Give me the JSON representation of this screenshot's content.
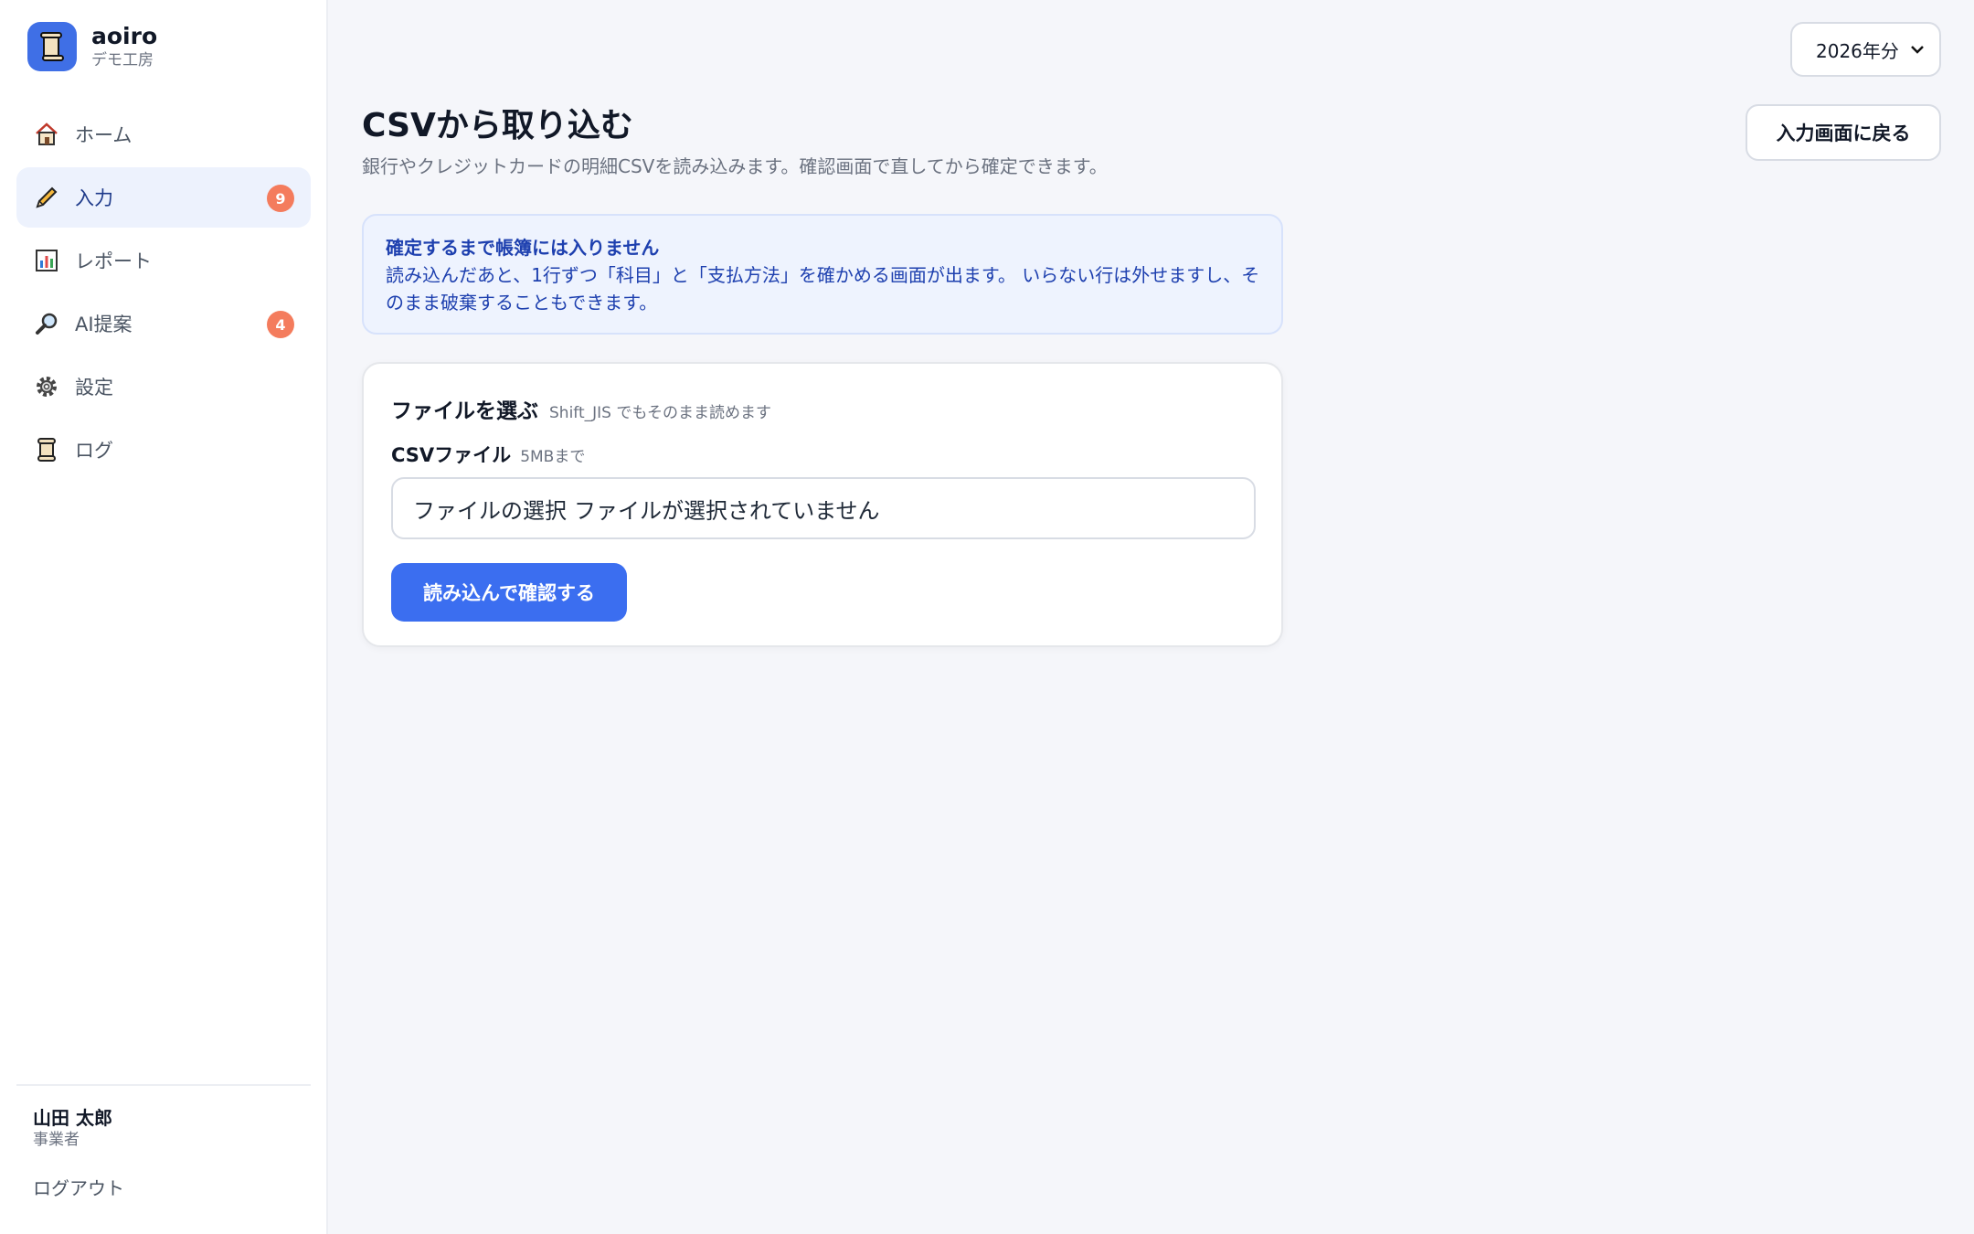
{
  "app": {
    "name": "aoiro",
    "workspace": "デモ工房"
  },
  "nav": [
    {
      "label": "ホーム",
      "icon": "home-icon"
    },
    {
      "label": "入力",
      "icon": "pencil-icon",
      "badge": "9",
      "active": true
    },
    {
      "label": "レポート",
      "icon": "bar-chart-icon"
    },
    {
      "label": "AI提案",
      "icon": "magnifier-icon",
      "badge": "4"
    },
    {
      "label": "設定",
      "icon": "gear-icon"
    },
    {
      "label": "ログ",
      "icon": "scroll-icon"
    }
  ],
  "user": {
    "name": "山田 太郎",
    "role": "事業者",
    "logout_label": "ログアウト"
  },
  "year_select": {
    "value": "2026年分"
  },
  "header": {
    "title": "CSVから取り込む",
    "subtitle": "銀行やクレジットカードの明細CSVを読み込みます。確認画面で直してから確定できます。",
    "back_label": "入力画面に戻る"
  },
  "notice": {
    "title": "確定するまで帳簿には入りません",
    "body": "読み込んだあと、1行ずつ「科目」と「支払方法」を確かめる画面が出ます。 いらない行は外せますし、そのまま破棄することもできます。"
  },
  "upload": {
    "title": "ファイルを選ぶ",
    "hint": "Shift_JIS でもそのまま読めます",
    "field_label": "CSVファイル",
    "field_hint": "5MBまで",
    "file_button": "ファイルの選択",
    "file_status": "ファイルが選択されていません",
    "submit_label": "読み込んで確認する"
  },
  "colors": {
    "accent": "#3b6ef0",
    "badge": "#f47c5d",
    "notice_bg": "#eef3fe",
    "notice_text": "#1e40af"
  }
}
